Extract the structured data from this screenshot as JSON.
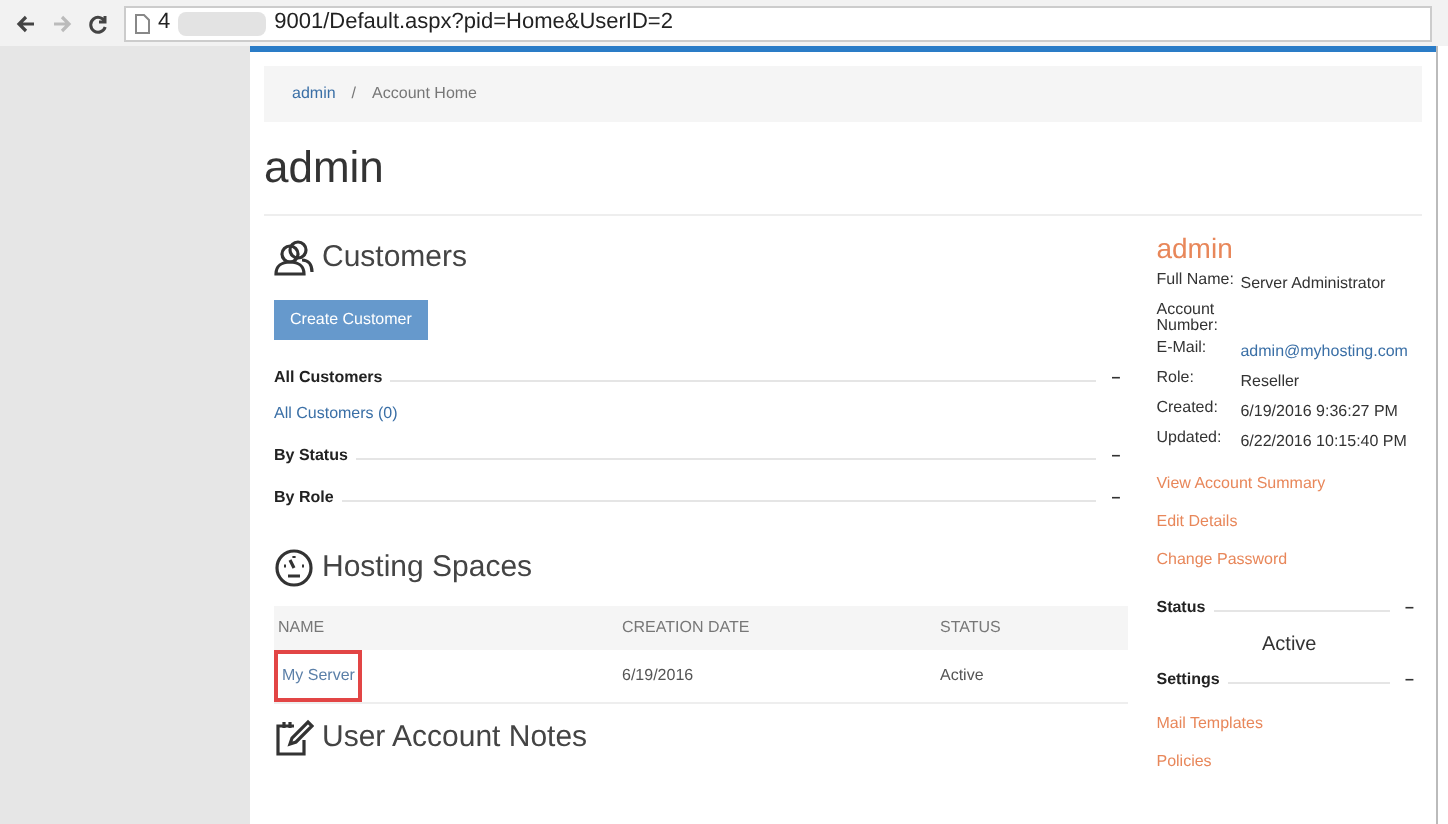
{
  "browser": {
    "address_start": "4",
    "address_end": "9001/Default.aspx?pid=Home&UserID=2"
  },
  "breadcrumb": [
    {
      "label": "admin",
      "link": true
    },
    {
      "label": "/",
      "link": false
    },
    {
      "label": "Account Home",
      "link": false
    }
  ],
  "page_title": "admin",
  "customers": {
    "title": "Customers",
    "button": "Create Customer",
    "groups": [
      {
        "title": "All Customers",
        "toggle": "–",
        "links": [
          "All Customers (0)"
        ]
      },
      {
        "title": "By Status",
        "toggle": "–"
      },
      {
        "title": "By Role",
        "toggle": "–"
      }
    ]
  },
  "hosting_spaces": {
    "title": "Hosting Spaces",
    "columns": [
      "NAME",
      "CREATION DATE",
      "STATUS"
    ],
    "rows": [
      {
        "name": "My Server",
        "date": "6/19/2016",
        "status": "Active",
        "highlighted": true
      }
    ]
  },
  "notes": {
    "title": "User Account Notes"
  },
  "account": {
    "name": "admin",
    "fields": [
      {
        "label": "Full Name:",
        "value": "Server Administrator",
        "kind": "text"
      },
      {
        "label": "Account Number:"
      },
      {
        "label": "E-Mail:",
        "value": "admin@myhosting.com",
        "kind": "link"
      },
      {
        "label": "Role:",
        "value": "Reseller",
        "kind": "text"
      },
      {
        "label": "Created:",
        "value": "6/19/2016 9:36:27 PM",
        "kind": "text"
      },
      {
        "label": "Updated:",
        "value": "6/22/2016 10:15:40 PM",
        "kind": "text"
      }
    ],
    "links": [
      "View Account Summary",
      "Edit Details",
      "Change Password"
    ],
    "status": {
      "title": "Status",
      "toggle": "–",
      "value": "Active"
    },
    "settings": {
      "title": "Settings",
      "toggle": "–",
      "links": [
        "Mail Templates",
        "Policies"
      ]
    }
  }
}
